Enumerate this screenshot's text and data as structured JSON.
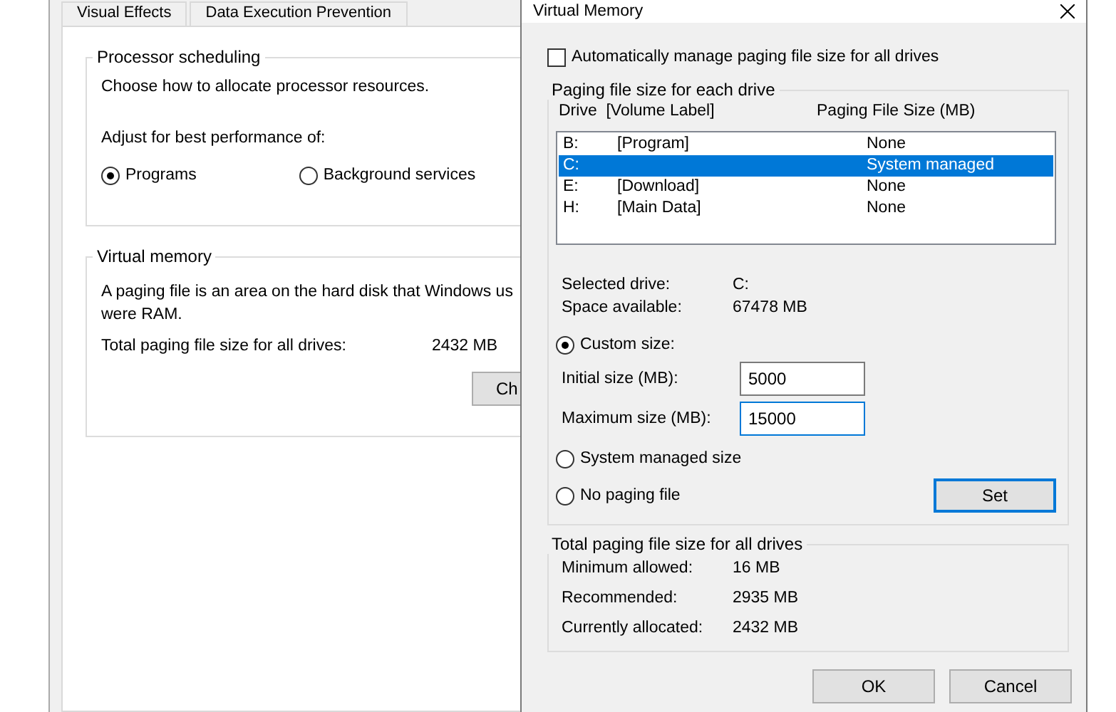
{
  "back_window": {
    "tabs": [
      {
        "label": "Visual Effects",
        "selected": false
      },
      {
        "label": "Data Execution Prevention",
        "selected": false
      }
    ],
    "processor_scheduling": {
      "title": "Processor scheduling",
      "description": "Choose how to allocate processor resources.",
      "adjust_label": "Adjust for best performance of:",
      "options": [
        {
          "label": "Programs",
          "selected": true
        },
        {
          "label": "Background services",
          "selected": false
        }
      ]
    },
    "virtual_memory": {
      "title": "Virtual memory",
      "description": "A paging file is an area on the hard disk that Windows us",
      "description_line_2": "were RAM.",
      "total_label": "Total paging file size for all drives:",
      "total_value": "2432 MB",
      "change_button": "Ch"
    }
  },
  "dialog": {
    "title": "Virtual Memory",
    "auto_manage": {
      "label": "Automatically manage paging file size for all drives",
      "checked": false
    },
    "drives_group": {
      "title": "Paging file size for each drive",
      "columns": [
        "Drive  [Volume Label]",
        "Paging File Size (MB)"
      ],
      "rows": [
        {
          "drive": "B:",
          "label": "[Program]",
          "size": "None",
          "selected": false
        },
        {
          "drive": "C:",
          "label": "",
          "size": "System managed",
          "selected": true
        },
        {
          "drive": "E:",
          "label": "[Download]",
          "size": "None",
          "selected": false
        },
        {
          "drive": "H:",
          "label": "[Main Data]",
          "size": "None",
          "selected": false
        }
      ],
      "info": [
        {
          "label": "Selected drive:",
          "value": "C:"
        },
        {
          "label": "Space available:",
          "value": "67478 MB"
        }
      ],
      "custom_size": {
        "label": "Custom size:",
        "selected": true
      },
      "fields": [
        {
          "label": "Initial size (MB):",
          "value": "5000",
          "focused": false
        },
        {
          "label": "Maximum size (MB):",
          "value": "15000",
          "focused": true
        }
      ],
      "other_options": [
        {
          "label": "System managed size",
          "selected": false
        },
        {
          "label": "No paging file",
          "selected": false
        }
      ],
      "set_button": "Set"
    },
    "totals_group": {
      "title": "Total paging file size for all drives",
      "rows": [
        {
          "label": "Minimum allowed:",
          "value": "16 MB"
        },
        {
          "label": "Recommended:",
          "value": "2935 MB"
        },
        {
          "label": "Currently allocated:",
          "value": "2432 MB"
        }
      ]
    },
    "buttons": [
      "OK",
      "Cancel"
    ]
  }
}
